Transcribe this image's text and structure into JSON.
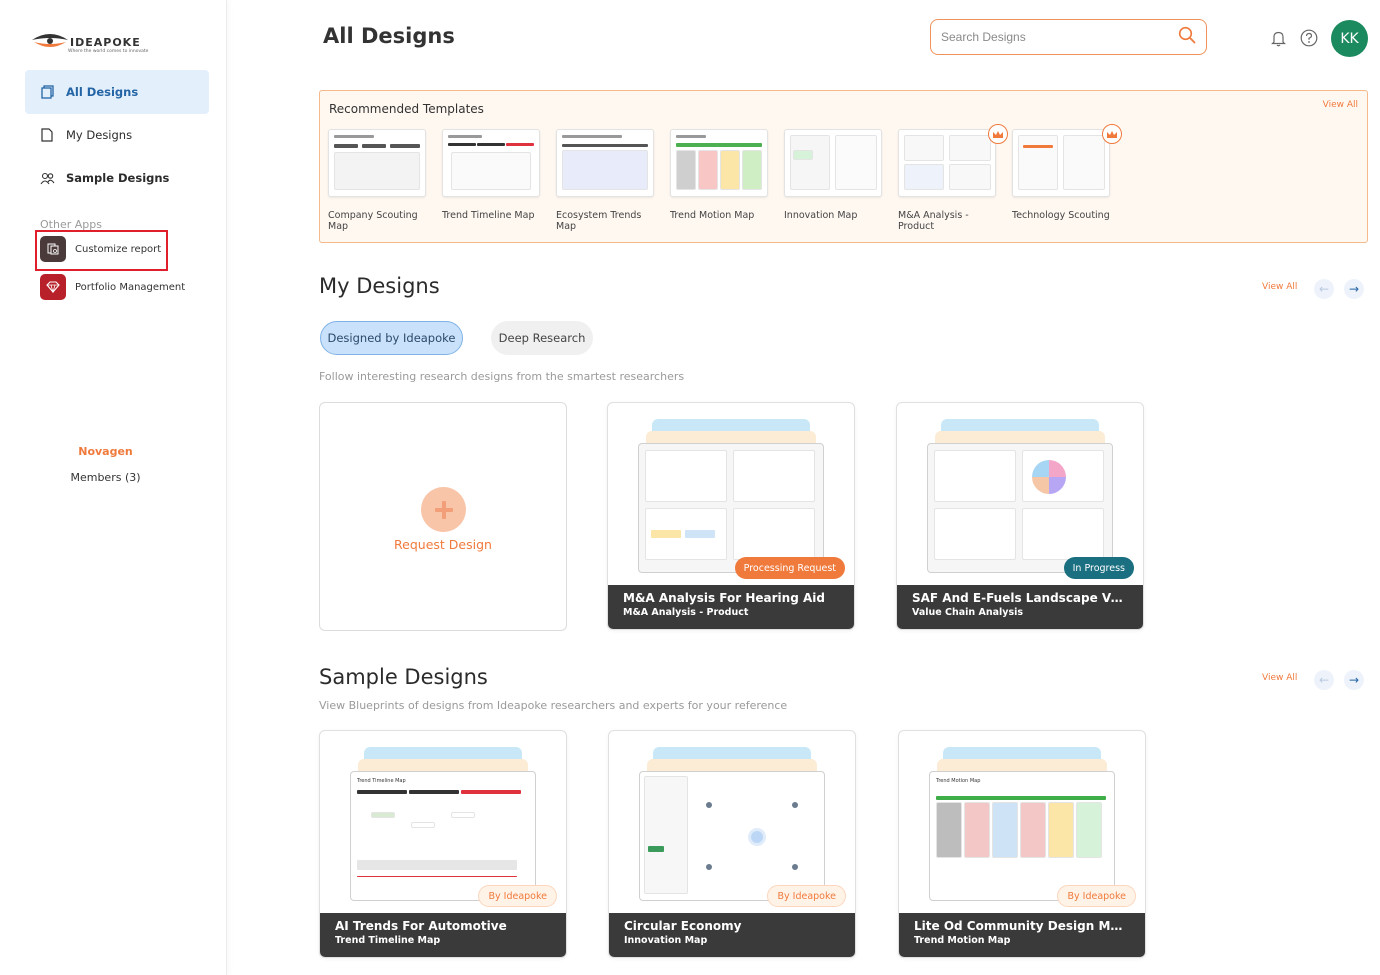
{
  "brand": {
    "name": "IDEAPOKE",
    "tagline": "Where the world comes to innovate"
  },
  "sidebar": {
    "nav": [
      {
        "label": "All Designs",
        "icon": "copy-icon",
        "active": true
      },
      {
        "label": "My Designs",
        "icon": "file-icon",
        "active": false
      },
      {
        "label": "Sample Designs",
        "icon": "users-icon",
        "active": false
      }
    ],
    "other_apps_label": "Other Apps",
    "apps": [
      {
        "label": "Customize report",
        "icon": "report-icon",
        "color": "#4a3a3a"
      },
      {
        "label": "Portfolio Management",
        "icon": "diamond-icon",
        "color": "#b8202a"
      }
    ],
    "org_name": "Novagen",
    "members_label": "Members (3)"
  },
  "header": {
    "title": "All Designs",
    "search_placeholder": "Search Designs",
    "avatar_initials": "KK"
  },
  "recommended": {
    "title": "Recommended Templates",
    "view_all": "View All",
    "templates": [
      {
        "name": "Company Scouting Map",
        "premium": false
      },
      {
        "name": "Trend Timeline Map",
        "premium": false
      },
      {
        "name": "Ecosystem Trends Map",
        "premium": false
      },
      {
        "name": "Trend Motion Map",
        "premium": false
      },
      {
        "name": "Innovation Map",
        "premium": false
      },
      {
        "name": "M&A Analysis - Product",
        "premium": true
      },
      {
        "name": "Technology Scouting",
        "premium": true
      }
    ]
  },
  "my_designs": {
    "title": "My Designs",
    "view_all": "View All",
    "tabs": [
      "Designed by Ideapoke",
      "Deep Research"
    ],
    "subtitle": "Follow interesting research designs from the smartest researchers",
    "request_label": "Request Design",
    "cards": [
      {
        "title": "M&A Analysis For Hearing Aid",
        "subtitle": "M&A Analysis - Product",
        "status": "Processing Request"
      },
      {
        "title": "SAF And E-Fuels Landscape Valu...",
        "subtitle": "Value Chain Analysis",
        "status": "In Progress"
      }
    ]
  },
  "sample_designs": {
    "title": "Sample Designs",
    "view_all": "View All",
    "subtitle": "View Blueprints of designs from Ideapoke researchers and experts for your reference",
    "cards": [
      {
        "title": "AI Trends For Automotive",
        "subtitle": "Trend Timeline Map",
        "badge": "By Ideapoke",
        "doc_title": "Trend Timeline Map"
      },
      {
        "title": "Circular Economy",
        "subtitle": "Innovation Map",
        "badge": "By Ideapoke",
        "doc_title": ""
      },
      {
        "title": "Lite Od Community Design Motio...",
        "subtitle": "Trend Motion Map",
        "badge": "By Ideapoke",
        "doc_title": "Trend Motion Map"
      }
    ]
  },
  "colors": {
    "accent": "#f07a3c",
    "active_nav_bg": "#e3f0fc",
    "avatar": "#1b8a5f",
    "card_footer": "#3a3a3a"
  }
}
